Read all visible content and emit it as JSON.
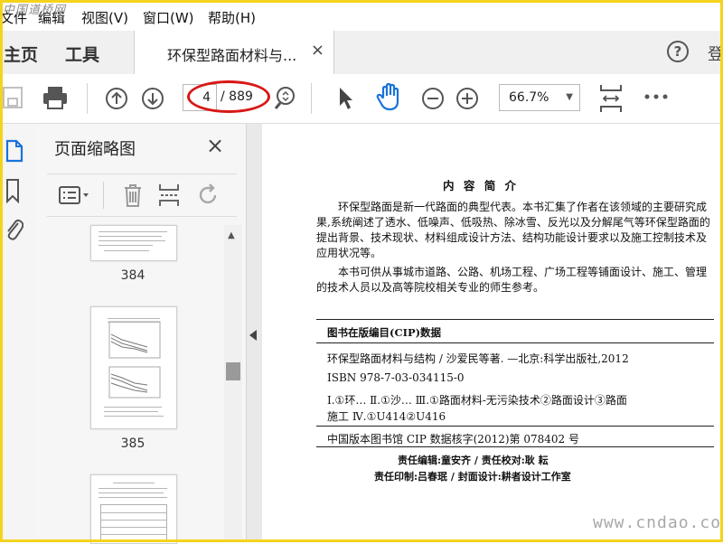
{
  "watermark_top": "中国道桥网",
  "menu": [
    "文件",
    "编辑",
    "视图(V)",
    "窗口(W)",
    "帮助(H)"
  ],
  "tabs": {
    "home": "主页",
    "tools": "工具",
    "document": "环保型路面材料与...",
    "close": "×"
  },
  "header": {
    "help": "?",
    "signin": "登"
  },
  "toolbar": {
    "current_page": "4",
    "total_pages": "/ 889",
    "zoom": "66.7%"
  },
  "thumbnails": {
    "title": "页面缩略图",
    "close": "×",
    "page_labels": [
      "384",
      "385"
    ]
  },
  "document": {
    "intro_title": "内 容 简 介",
    "paragraph1": "环保型路面是新一代路面的典型代表。本书汇集了作者在该领域的主要研究成果,系统阐述了透水、低噪声、低吸热、除冰雪、反光以及分解尾气等环保型路面的提出背景、技术现状、材料组成设计方法、结构功能设计要求以及施工控制技术及应用状况等。",
    "paragraph2": "本书可供从事城市道路、公路、机场工程、广场工程等铺面设计、施工、管理的技术人员以及高等院校相关专业的师生参考。",
    "cip_heading": "图书在版编目(CIP)数据",
    "cip_line1": "环保型路面材料与结构 / 沙爱民等著. —北京:科学出版社,2012",
    "isbn": "ISBN 978-7-03-034115-0",
    "classification_a": "Ⅰ.①环…  Ⅱ.①沙…  Ⅲ.①路面材料-无污染技术②路面设计③路面",
    "classification_b": "施工  Ⅳ.①U414②U416",
    "cip_number": "中国版本图书馆 CIP 数据核字(2012)第 078402 号",
    "editors": "责任编辑:童安齐 / 责任校对:耿  耘",
    "printing": "责任印制:吕春珉 / 封面设计:耕者设计工作室"
  },
  "watermark_bottom": "www.cndao.com",
  "colors": {
    "highlight": "#d81818",
    "frame": "#f5d31c"
  }
}
